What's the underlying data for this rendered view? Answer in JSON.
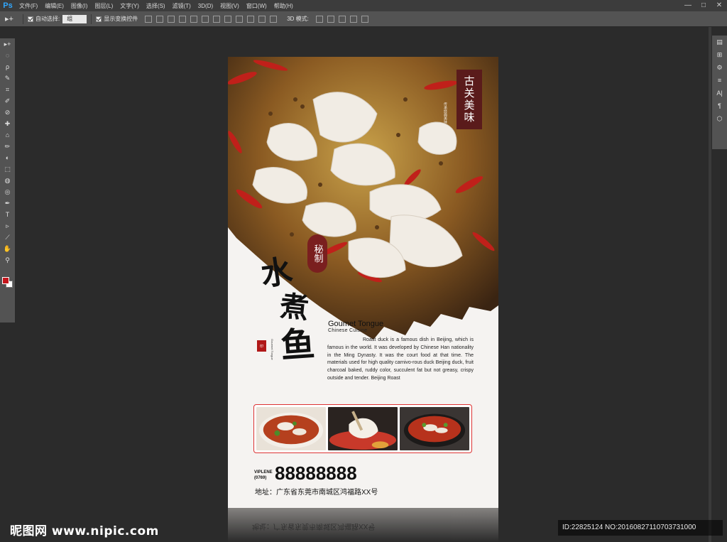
{
  "app": {
    "logo": "Ps"
  },
  "menu": [
    "文件(F)",
    "编辑(E)",
    "图像(I)",
    "图层(L)",
    "文字(Y)",
    "选择(S)",
    "滤镜(T)",
    "3D(D)",
    "视图(V)",
    "窗口(W)",
    "帮助(H)"
  ],
  "window_controls": [
    "—",
    "□",
    "✕"
  ],
  "options_bar": {
    "tool_glyph": "▸+",
    "auto_select_label": "自动选择:",
    "auto_select_value": "组",
    "show_transform_label": "显示变换控件",
    "mode_3d_label": "3D 模式:"
  },
  "left_tools": [
    "▸+",
    "◌",
    "ρ",
    "✎",
    "⌗",
    "✐",
    "⊘",
    "✚",
    "⌂",
    "✏",
    "◐",
    "⬚",
    "◍",
    "◎",
    "✒",
    "T",
    "▹",
    "⟋",
    "✋",
    "⚲"
  ],
  "right_tools": [
    "▤",
    "⊞",
    "⚙",
    "≡",
    "A|",
    "¶",
    "⬡"
  ],
  "colors": {
    "foreground": "#c4161c",
    "background": "#ffffff",
    "accent_red": "#7a1f1f",
    "badge_dark": "#5a1b1b"
  },
  "poster": {
    "badge_text": "古关美味",
    "badge_small": "传承经典美味",
    "mizhi": "秘制",
    "title_1": "水",
    "title_2": "煮",
    "title_3": "鱼",
    "seal_text": "印",
    "seal_caption": "Gourmet Tongue",
    "heading": "Goumet Tongue",
    "subheading": "Chinese  Cuisine",
    "description": "Roast duck is a famous dish in Beijing, which is famous in the world. It was developed by Chinese Han nationality in the Ming Dynasty. It was the court food at that time. The materials used for high quality carnivo-rous duck Beijing duck, fruit charcoal baked, ruddy color, succulent fat but not greasy, crispy outside and tender. Beijing Roast",
    "vip_label": "VIPLENE",
    "area_code": "(0769)",
    "phone": "88888888",
    "address": "地址：广东省东莞市南城区鸿福路XX号"
  },
  "watermark": {
    "left": "昵图网 www.nipic.com",
    "right": "ID:22825124 NO:20160827110703731000"
  }
}
